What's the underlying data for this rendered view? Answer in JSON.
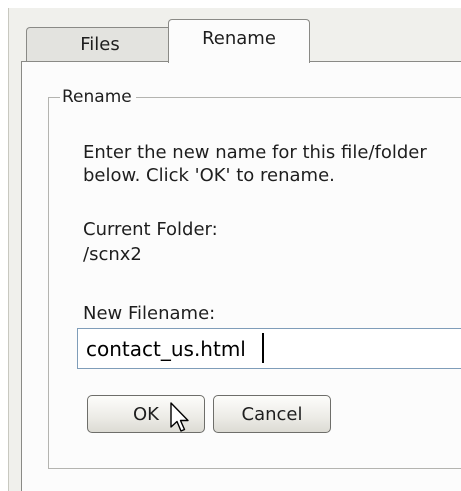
{
  "tabs": [
    {
      "label": "Files",
      "active": false
    },
    {
      "label": "Rename",
      "active": true
    }
  ],
  "rename_group": {
    "legend": "Rename",
    "instructions_line1": "Enter the new name for this file/folder",
    "instructions_line2": "below. Click 'OK' to rename.",
    "current_folder_label": "Current Folder:",
    "current_folder_value": "/scnx2",
    "new_filename_label": "New Filename:",
    "new_filename_value": "contact_us.html"
  },
  "buttons": {
    "ok_label": "OK",
    "cancel_label": "Cancel"
  },
  "cursor_icon": "mouse-pointer-icon"
}
